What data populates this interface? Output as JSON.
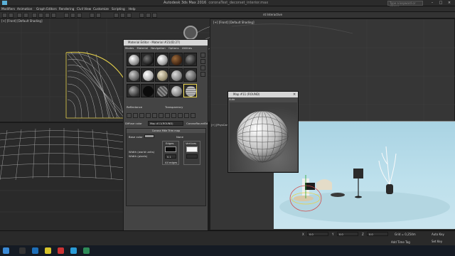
{
  "app": {
    "title": "Autodesk 3ds Max 2016",
    "filename": "coronaTest_decorset_interior.max",
    "search_placeholder": "Type a keyword or phrase"
  },
  "menus": [
    "Modifiers",
    "Animation",
    "Graph Editors",
    "Rendering",
    "Civil View",
    "Customize",
    "Scripting",
    "Help"
  ],
  "toolbar": {
    "interactive_label": "nt Interactive"
  },
  "viewport": {
    "label": "[+] [Front] [Default Shading]"
  },
  "persp_viewport": {
    "label": "[+] [PhysCamera]"
  },
  "material_editor": {
    "title": "Material Editor - Material #21(ID:27)",
    "menu": [
      "Modes",
      "Material",
      "Navigation",
      "Options",
      "Utilities"
    ],
    "reflectance_label": "Reflectance",
    "transparency_label": "Transparency",
    "diffuse_label": "Diffuse color",
    "map_field": "Map #11(ROUND)",
    "map_type": "CoronaRoundEdges",
    "rollout": {
      "title": "Corona Mtle Trim map",
      "base_color_label": "Base color",
      "none_label": "None",
      "width_world": "Width (world units)",
      "width_pixels": "Width (pixels)",
      "edges_label": "Edges",
      "vertices_label": "Vertices",
      "value": "0.1",
      "all_edges": "All edges"
    }
  },
  "map_window": {
    "title": "Map #11 (ROUND)",
    "sub": "Auto"
  },
  "status": {
    "x_label": "X",
    "x_value": "0,0",
    "y_label": "Y",
    "y_value": "0,0",
    "z_label": "Z",
    "z_value": "0,0",
    "grid": "Grid = 0,254m",
    "add_time_tag": "Add Time Tag",
    "auto_key": "Auto Key",
    "set_key": "Set Key"
  },
  "colors": {
    "accent_yellow": "#e7d24c",
    "viewport_bg": "#363636",
    "sky": "#bde0ec"
  },
  "icons": [
    "close-icon",
    "minimize-icon",
    "maximize-icon",
    "viewcube-icon",
    "windows-start-icon"
  ]
}
